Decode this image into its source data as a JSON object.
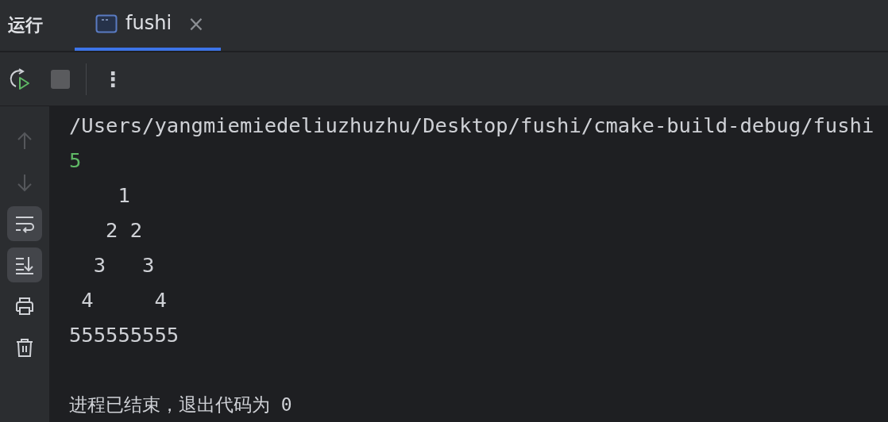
{
  "panel": {
    "title": "运行"
  },
  "tabs": [
    {
      "label": "fushi",
      "selected": true,
      "close": "×"
    }
  ],
  "toolbar": {
    "more": "⋮"
  },
  "sidebar": [
    {
      "kind": "up",
      "on": false,
      "disabled": true
    },
    {
      "kind": "down",
      "on": false,
      "disabled": true
    },
    {
      "kind": "wrap",
      "on": true,
      "disabled": false
    },
    {
      "kind": "scroll",
      "on": true,
      "disabled": false
    },
    {
      "kind": "print",
      "on": false,
      "disabled": false
    },
    {
      "kind": "trash",
      "on": false,
      "disabled": false
    }
  ],
  "console": {
    "lines": [
      {
        "kind": "command",
        "text": "/Users/yangmiemiedeliuzhuzhu/Desktop/fushi/cmake-build-debug/fushi"
      },
      {
        "kind": "input",
        "text": "5"
      },
      {
        "kind": "output",
        "text": "    1"
      },
      {
        "kind": "output",
        "text": "   2 2"
      },
      {
        "kind": "output",
        "text": "  3   3"
      },
      {
        "kind": "output",
        "text": " 4     4"
      },
      {
        "kind": "output",
        "text": "555555555"
      },
      {
        "kind": "exit",
        "text": "进程已结束，退出代码为 0"
      }
    ]
  }
}
